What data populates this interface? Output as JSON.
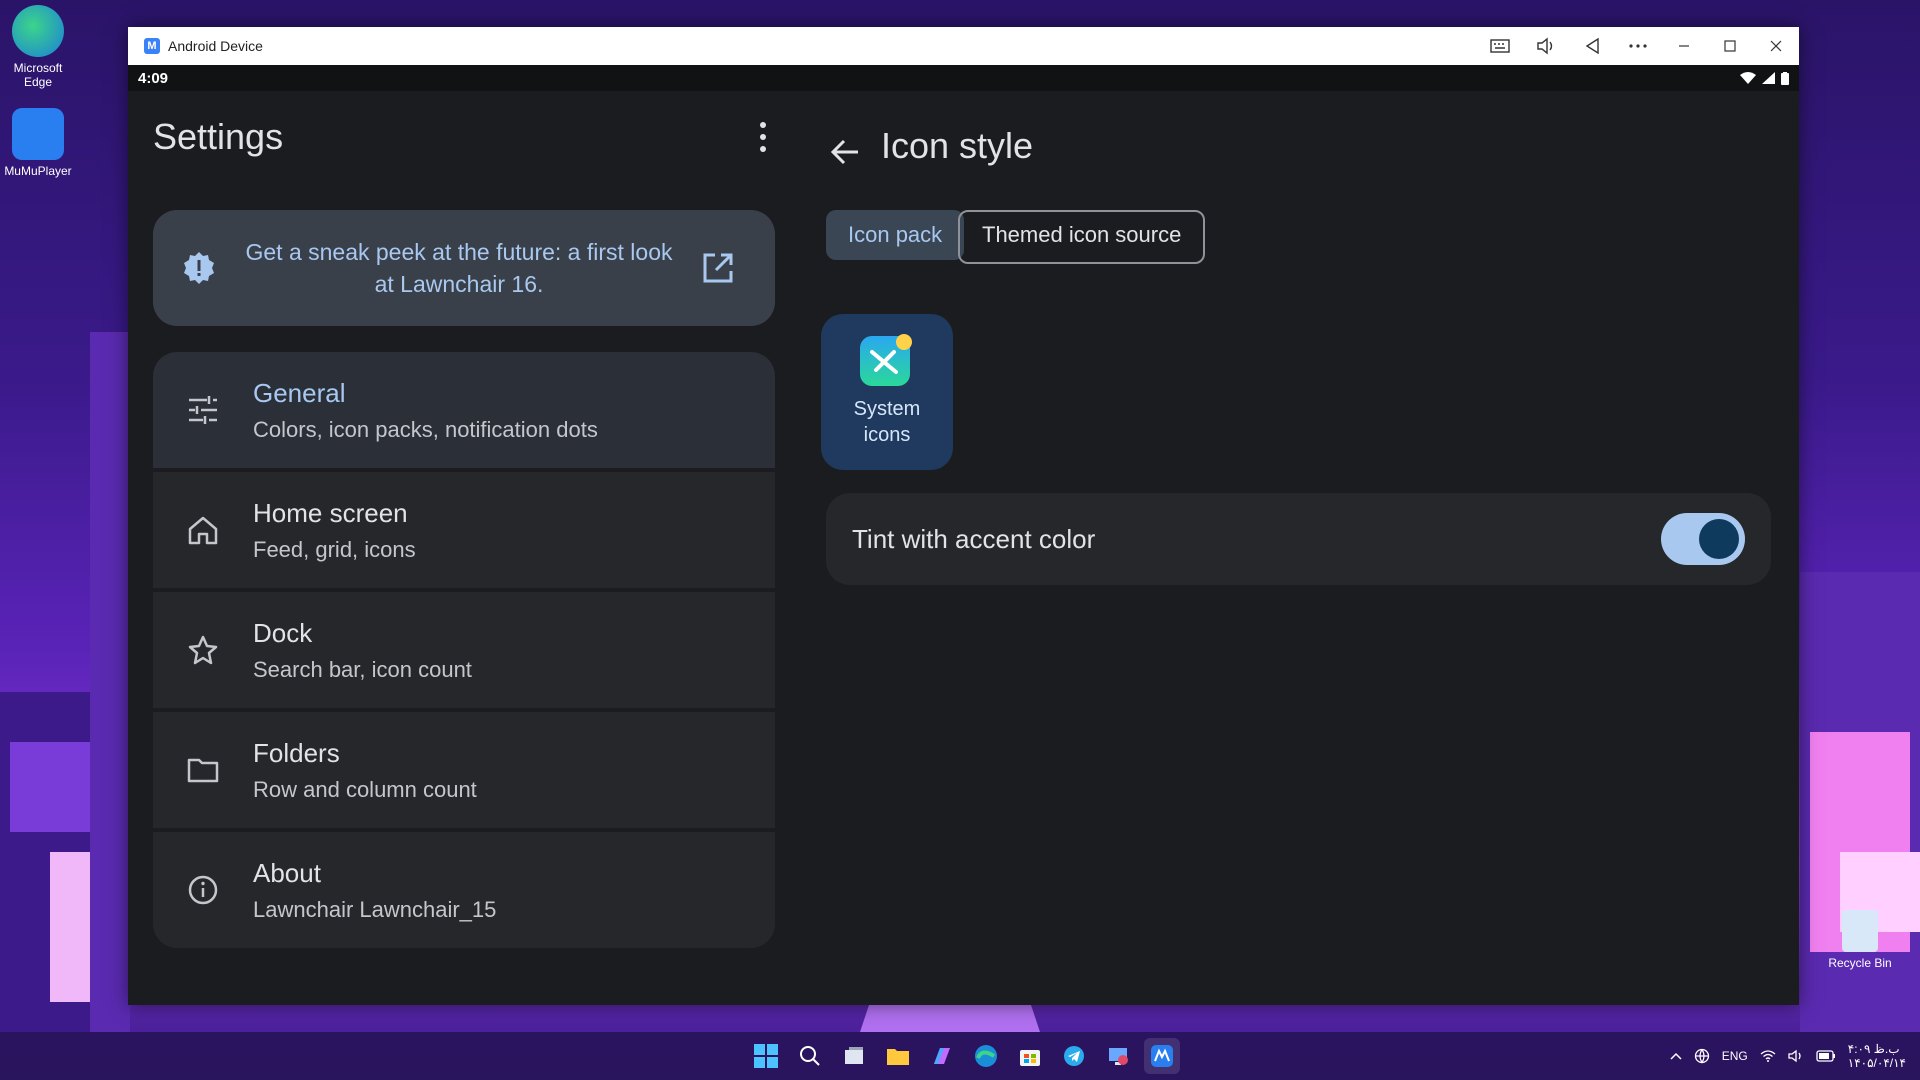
{
  "desktop": {
    "icons": [
      {
        "label": "Microsoft Edge"
      },
      {
        "label": "MuMuPlayer"
      },
      {
        "label": "Recycle Bin"
      }
    ]
  },
  "window": {
    "title": "Android Device",
    "controls": [
      "keyboard-icon",
      "volume-icon",
      "back-icon",
      "more-icon",
      "minimize-icon",
      "maximize-icon",
      "close-icon"
    ]
  },
  "statusbar": {
    "time": "4:09"
  },
  "settings": {
    "title": "Settings",
    "banner": "Get a sneak peek at the future: a first look at Lawnchair 16.",
    "items": [
      {
        "title": "General",
        "subtitle": "Colors, icon packs, notification dots",
        "icon": "sliders-icon"
      },
      {
        "title": "Home screen",
        "subtitle": "Feed, grid, icons",
        "icon": "home-icon"
      },
      {
        "title": "Dock",
        "subtitle": "Search bar, icon count",
        "icon": "star-icon"
      },
      {
        "title": "Folders",
        "subtitle": "Row and column count",
        "icon": "folder-icon"
      },
      {
        "title": "About",
        "subtitle": "Lawnchair Lawnchair_15",
        "icon": "info-icon"
      }
    ]
  },
  "icon_style": {
    "title": "Icon style",
    "tabs": [
      "Icon pack",
      "Themed icon source"
    ],
    "selected_tab": "Icon pack",
    "tile_label": "System icons",
    "tint_label": "Tint with accent color",
    "tint_enabled": true
  },
  "taskbar": {
    "language": "ENG",
    "clock_time": "ب.ظ ۴:۰۹",
    "clock_date": "۱۴۰۵/۰۴/۱۴"
  },
  "colors": {
    "accent": "#a8c8f0",
    "surface": "#25272b",
    "background": "#1b1c1f"
  }
}
